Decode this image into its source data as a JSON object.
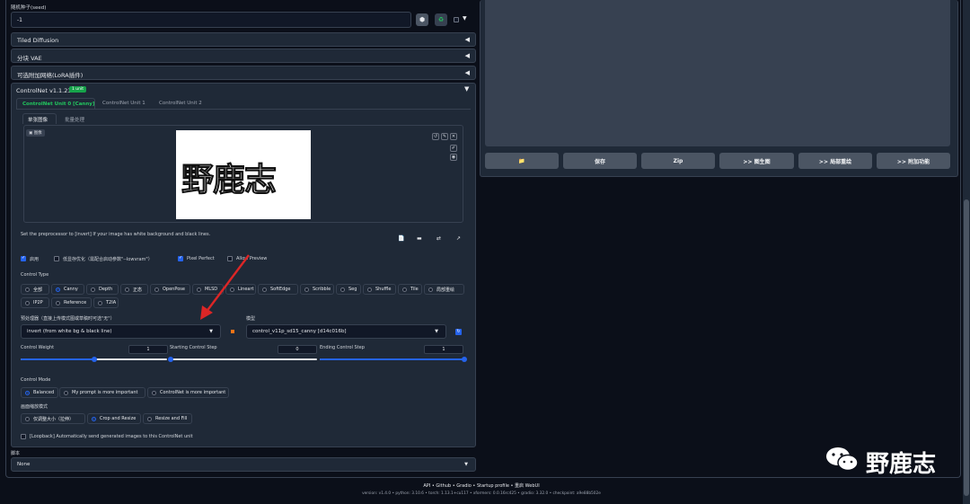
{
  "seed": {
    "label": "随机种子(seed)",
    "value": "-1"
  },
  "accordions": [
    {
      "title": "Tiled Diffusion",
      "arrow": "◀"
    },
    {
      "title": "分块 VAE",
      "arrow": "◀"
    },
    {
      "title": "可选附加网络(LoRA插件)",
      "arrow": "◀"
    }
  ],
  "controlnet": {
    "title": "ControlNet v1.1.231",
    "badge": "1 unit",
    "arrow": "▼",
    "units": [
      "ControlNet Unit 0 [Canny]",
      "ControlNet Unit 1",
      "ControlNet Unit 2"
    ],
    "subtabs": [
      "单张图像",
      "批量处理"
    ],
    "image_label": "图像",
    "image_text": "野鹿志",
    "image_tool_icons": [
      "undo-icon",
      "edit-icon",
      "close-icon"
    ],
    "image_side_icons": [
      "pencil-icon",
      "camera-icon"
    ],
    "hint": "Set the preprocessor to [invert] If your image has white background and black lines.",
    "tool_icons": [
      "new-canvas-icon",
      "webcam-icon",
      "swap-icon",
      "send-size-icon"
    ],
    "checks": [
      {
        "label": "启用",
        "checked": true
      },
      {
        "label": "低显存优化（需配合启动参数\"--lowvram\"）",
        "checked": false
      },
      {
        "label": "Pixel Perfect",
        "checked": true
      },
      {
        "label": "Allow Preview",
        "checked": false
      }
    ],
    "control_type_label": "Control Type",
    "control_types_row1": [
      "全部",
      "Canny",
      "Depth",
      "正态",
      "OpenPose",
      "MLSD",
      "Lineart",
      "SoftEdge",
      "Scribble",
      "Seg",
      "Shuffle",
      "Tile",
      "局部重绘"
    ],
    "control_types_row2": [
      "IP2P",
      "Reference",
      "T2IA"
    ],
    "selected_type": "Canny",
    "preprocessor_label": "预处理器（直接上传模式图或草稿时可选\"无\"）",
    "preprocessor_value": "invert (from white bg & black line)",
    "model_label": "模型",
    "model_value": "control_v11p_sd15_canny [d14c016b]",
    "sliders": [
      {
        "label": "Control Weight",
        "value": "1",
        "fraction": 0.5
      },
      {
        "label": "Starting Control Step",
        "value": "0",
        "fraction": 0.0
      },
      {
        "label": "Ending Control Step",
        "value": "1",
        "fraction": 1.0
      }
    ],
    "control_mode_label": "Control Mode",
    "control_modes": [
      "Balanced",
      "My prompt is more important",
      "ControlNet is more important"
    ],
    "selected_mode": "Balanced",
    "resize_label": "画面缩放模式",
    "resize_modes": [
      "仅调整大小（拉伸）",
      "Crop and Resize",
      "Resize and Fill"
    ],
    "selected_resize": "Crop and Resize",
    "loopback_label": "[Loopback] Automatically send generated images to this ControlNet unit"
  },
  "script": {
    "label": "脚本",
    "value": "None"
  },
  "right_buttons": [
    "📁",
    "保存",
    "Zip",
    ">> 图生图",
    ">> 局部重绘",
    ">> 附加功能"
  ],
  "footer": {
    "links": "API  •  Github  •  Gradio  •  Startup profile  •  重启 WebUI",
    "version": "version: v1.4.0  •  python: 3.10.6  •  torch: 1.13.1+cu117  •  xformers: 0.0.16rc425  •  gradio: 3.32.0  •  checkpoint: a9e88b502e"
  },
  "watermark": "野鹿志",
  "colors": {
    "accent": "#2563eb",
    "green": "#22c55e",
    "arrow": "#dc2626"
  }
}
